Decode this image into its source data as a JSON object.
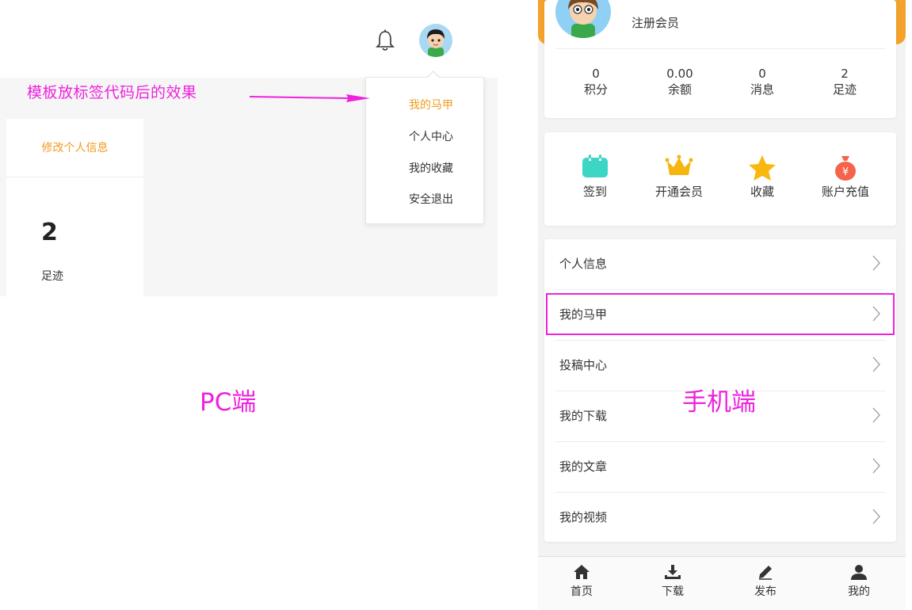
{
  "pc": {
    "sidebar": {
      "edit_profile": "修改个人信息",
      "stat_value": "2",
      "stat_label": "足迹"
    },
    "dropdown": {
      "items": [
        "我的马甲",
        "个人中心",
        "我的收藏",
        "安全退出"
      ],
      "active_color": "#f19b1f"
    },
    "annotation": "模板放标签代码后的效果",
    "caption": "PC端"
  },
  "mobile": {
    "role": "注册会员",
    "stats": [
      {
        "value": "0",
        "label": "积分"
      },
      {
        "value": "0.00",
        "label": "余额"
      },
      {
        "value": "0",
        "label": "消息"
      },
      {
        "value": "2",
        "label": "足迹"
      }
    ],
    "actions": [
      {
        "label": "签到",
        "icon": "calendar-icon",
        "color": "#3dd6c4"
      },
      {
        "label": "开通会员",
        "icon": "crown-icon",
        "color": "#f6b50f"
      },
      {
        "label": "收藏",
        "icon": "star-icon",
        "color": "#f8b80e"
      },
      {
        "label": "账户充值",
        "icon": "money-bag-icon",
        "color": "#f5634a"
      }
    ],
    "menu": [
      "个人信息",
      "我的马甲",
      "投稿中心",
      "我的下载",
      "我的文章",
      "我的视频"
    ],
    "tabs": [
      "首页",
      "下载",
      "发布",
      "我的"
    ],
    "caption": "手机端"
  },
  "colors": {
    "annotation": "#ee22dd",
    "accent": "#f3a22b"
  }
}
